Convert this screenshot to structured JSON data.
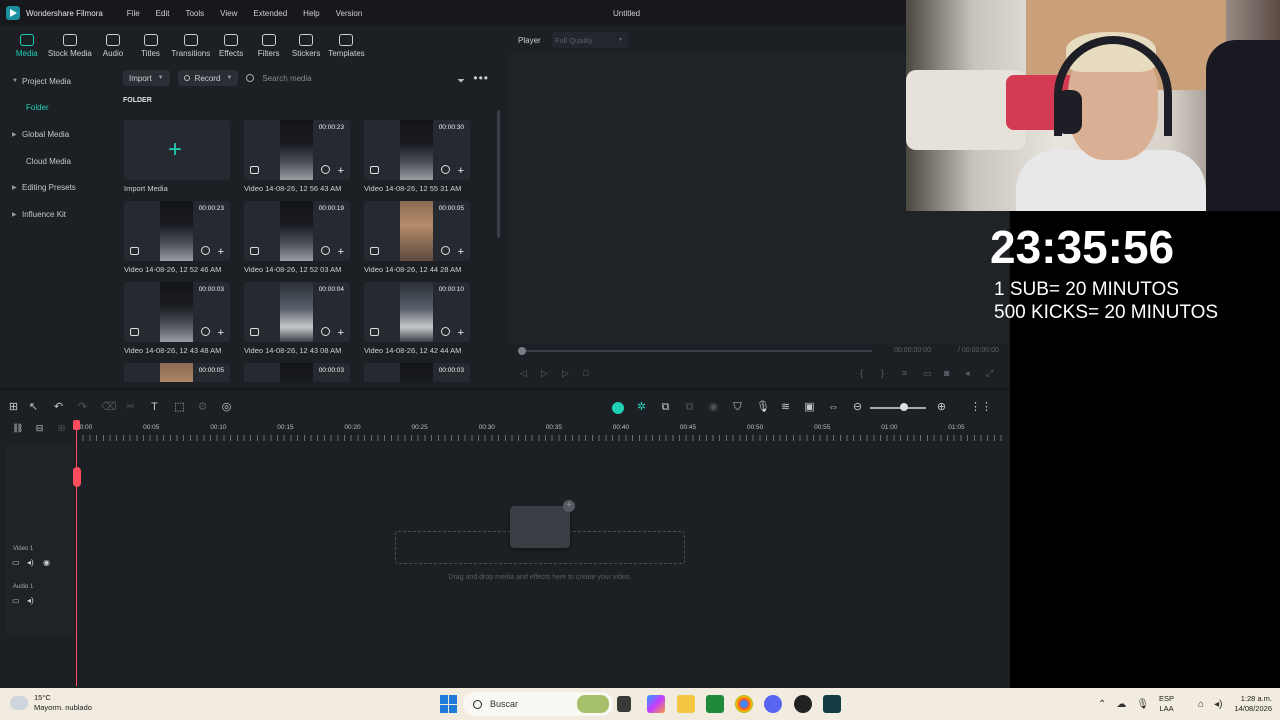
{
  "titlebar": {
    "app_name": "Wondershare Filmora",
    "menu": [
      "File",
      "Edit",
      "Tools",
      "View",
      "Extended",
      "Help",
      "Version"
    ],
    "doc_title": "Untitled"
  },
  "mode_tabs": [
    {
      "label": "Media",
      "icon": "media-icon",
      "active": true
    },
    {
      "label": "Stock Media",
      "icon": "stock-media-icon"
    },
    {
      "label": "Audio",
      "icon": "music-note-icon"
    },
    {
      "label": "Titles",
      "icon": "titles-t-icon"
    },
    {
      "label": "Transitions",
      "icon": "transitions-icon"
    },
    {
      "label": "Effects",
      "icon": "effects-sparkle-icon"
    },
    {
      "label": "Filters",
      "icon": "filters-icon"
    },
    {
      "label": "Stickers",
      "icon": "stickers-icon"
    },
    {
      "label": "Templates",
      "icon": "templates-icon"
    }
  ],
  "sidenav": {
    "project_media": "Project Media",
    "folder": "Folder",
    "global_media": "Global Media",
    "cloud_media": "Cloud Media",
    "editing_presets": "Editing Presets",
    "influence_kit": "Influence Kit"
  },
  "media_toolbar": {
    "import_label": "Import",
    "record_label": "Record",
    "search_placeholder": "Search media"
  },
  "folder_label": "FOLDER",
  "media": {
    "import_label": "Import Media",
    "items": [
      {
        "name": "Video 14-08-26, 12 56 43 AM",
        "duration": "00:00:23"
      },
      {
        "name": "Video 14-08-26, 12 55 31 AM",
        "duration": "00:00:30"
      },
      {
        "name": "Video 14-08-26, 12 52 46 AM",
        "duration": "00:00:23"
      },
      {
        "name": "Video 14-08-26, 12 52 03 AM",
        "duration": "00:00:19"
      },
      {
        "name": "Video 14-08-26, 12 44 28 AM",
        "duration": "00:00:05"
      },
      {
        "name": "Video 14-08-26, 12 43 48 AM",
        "duration": "00:00:03"
      },
      {
        "name": "Video 14-08-26, 12 43 08 AM",
        "duration": "00:00:04"
      },
      {
        "name": "Video 14-08-26, 12 42 44 AM",
        "duration": "00:00:10"
      },
      {
        "name": "",
        "duration": "00:00:05"
      },
      {
        "name": "",
        "duration": "00:00:03"
      },
      {
        "name": "",
        "duration": "00:00:03"
      }
    ]
  },
  "player": {
    "label": "Player",
    "quality": "Full Quality",
    "current_time": "00:00:00:00",
    "total_time": "/ 00:00:00:00"
  },
  "ruler_ticks": [
    "00:00",
    "00:05",
    "00:10",
    "00:15",
    "00:20",
    "00:25",
    "00:30",
    "00:35",
    "00:40",
    "00:45",
    "00:50",
    "00:55",
    "01:00",
    "01:05"
  ],
  "tracks": {
    "video": "Video 1",
    "audio": "Audio 1"
  },
  "dropzone_text": "Drag and drop media and effects here to create your video.",
  "overlay": {
    "countdown": "23:35:56",
    "rule1": "1 SUB= 20 MINUTOS",
    "rule2": "500 KICKS= 20 MINUTOS"
  },
  "taskbar": {
    "temperature": "15°C",
    "weather": "Mayorm. nublado",
    "search_placeholder": "Buscar",
    "lang1": "ESP",
    "lang2": "LAA",
    "time": "1:28 a.m.",
    "date": "14/08/2026"
  }
}
